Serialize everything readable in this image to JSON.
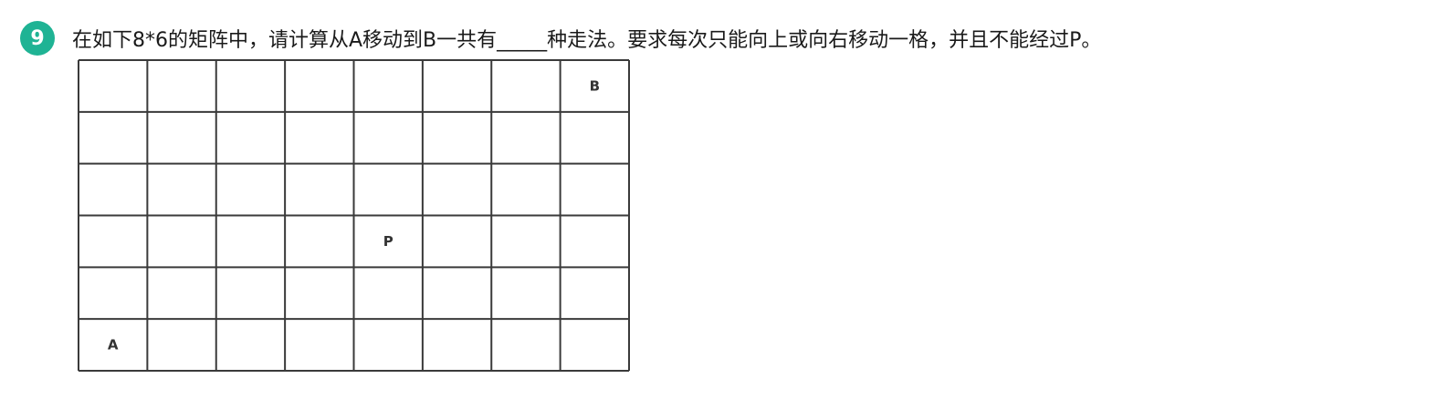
{
  "question": {
    "number": "9",
    "text": "在如下8*6的矩阵中，请计算从A移动到B一共有_____种走法。要求每次只能向上或向右移动一格，并且不能经过P。"
  },
  "grid": {
    "columns": 8,
    "rows": 6,
    "border_color": "#3a3a3a",
    "labels": [
      {
        "text": "A",
        "col": 0,
        "row": 5
      },
      {
        "text": "P",
        "col": 4,
        "row": 3
      },
      {
        "text": "B",
        "col": 7,
        "row": 0
      }
    ]
  },
  "colors": {
    "badge": "#1fb394",
    "text": "#1a1a1a"
  }
}
